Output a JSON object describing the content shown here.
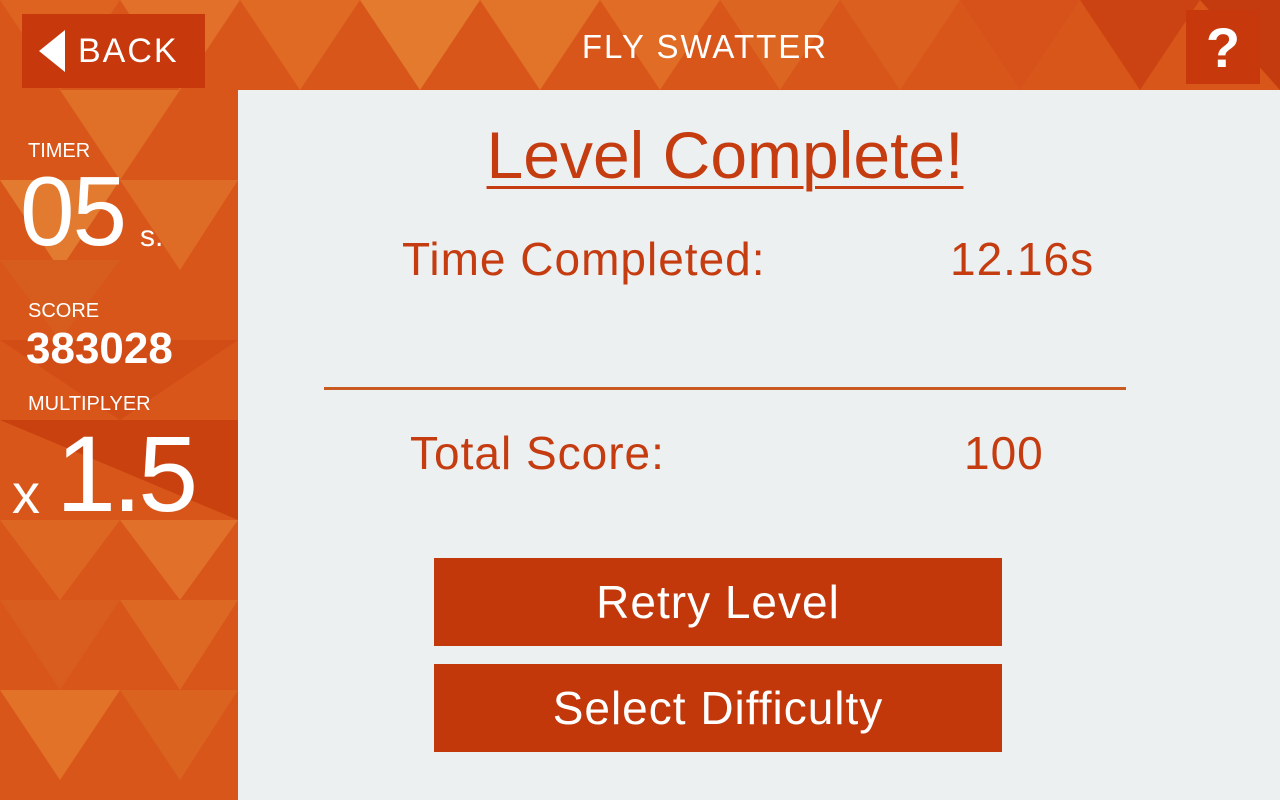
{
  "header": {
    "back_label": "BACK",
    "title": "FLY SWATTER",
    "help_label": "?"
  },
  "sidebar": {
    "timer_label": "TIMER",
    "timer_value": "05",
    "timer_unit": "s.",
    "score_label": "SCORE",
    "score_value": "383028",
    "multiplier_label": "MULTIPLYER",
    "multiplier_prefix": "x",
    "multiplier_value": "1.5"
  },
  "result": {
    "heading": "Level Complete!",
    "time_label": "Time Completed:",
    "time_value": "12.16s",
    "total_label": "Total Score:",
    "total_value": "100"
  },
  "actions": {
    "retry_label": "Retry Level",
    "difficulty_label": "Select Difficulty"
  },
  "colors": {
    "accent": "#c53c11",
    "button": "#c2380b",
    "panel": "#ecf0f1",
    "background": "#d9561b"
  }
}
